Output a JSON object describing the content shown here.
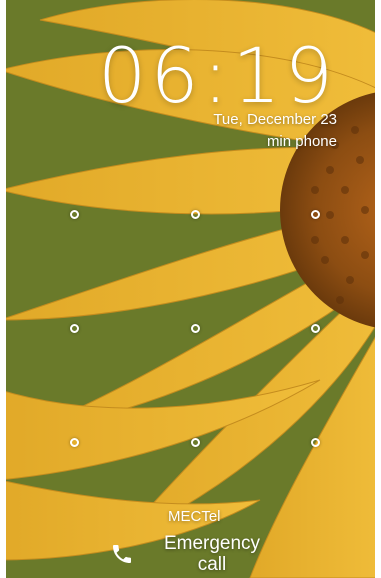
{
  "lockscreen": {
    "time": "06:19",
    "date": "Tue, December 23",
    "owner_info": "min phone",
    "carrier": "MECTel",
    "emergency_label": "Emergency call",
    "icons": {
      "emergency": "phone-icon"
    },
    "pattern_grid": {
      "rows": 3,
      "cols": 3
    }
  }
}
